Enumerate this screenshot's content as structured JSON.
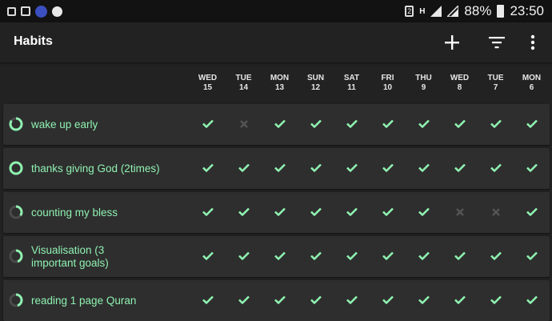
{
  "status_bar": {
    "notification_icons": [
      "clipboard-icon",
      "image-icon",
      "app-badge-icon",
      "settings-icon"
    ],
    "sim_label": "2",
    "network_label": "H",
    "battery": "88%",
    "time": "23:50"
  },
  "appbar": {
    "title": "Habits",
    "add_icon": "plus-icon",
    "filter_icon": "filter-icon",
    "menu_icon": "overflow-menu-icon"
  },
  "days": [
    {
      "dow": "WED",
      "day": "15"
    },
    {
      "dow": "TUE",
      "day": "14"
    },
    {
      "dow": "MON",
      "day": "13"
    },
    {
      "dow": "SUN",
      "day": "12"
    },
    {
      "dow": "SAT",
      "day": "11"
    },
    {
      "dow": "FRI",
      "day": "10"
    },
    {
      "dow": "THU",
      "day": "9"
    },
    {
      "dow": "WED",
      "day": "8"
    },
    {
      "dow": "TUE",
      "day": "7"
    },
    {
      "dow": "MON",
      "day": "6"
    }
  ],
  "habits": [
    {
      "name": "wake up early",
      "score": 0.85,
      "checks": [
        1,
        0,
        1,
        1,
        1,
        1,
        1,
        1,
        1,
        1
      ]
    },
    {
      "name": "thanks giving God (2times)",
      "score": 1.0,
      "checks": [
        1,
        1,
        1,
        1,
        1,
        1,
        1,
        1,
        1,
        1
      ]
    },
    {
      "name": "counting my bless",
      "score": 0.35,
      "checks": [
        1,
        1,
        1,
        1,
        1,
        1,
        1,
        0,
        0,
        1
      ]
    },
    {
      "name": "Visualisation (3\nimportant goals)",
      "score": 0.45,
      "checks": [
        1,
        1,
        1,
        1,
        1,
        1,
        1,
        1,
        1,
        1
      ]
    },
    {
      "name": "reading 1 page Quran",
      "score": 0.45,
      "checks": [
        1,
        1,
        1,
        1,
        1,
        1,
        1,
        1,
        1,
        1
      ]
    }
  ],
  "colors": {
    "accent": "#8ff1b1",
    "unchecked": "#555555",
    "card": "#2e2e2e",
    "background": "#222222"
  }
}
